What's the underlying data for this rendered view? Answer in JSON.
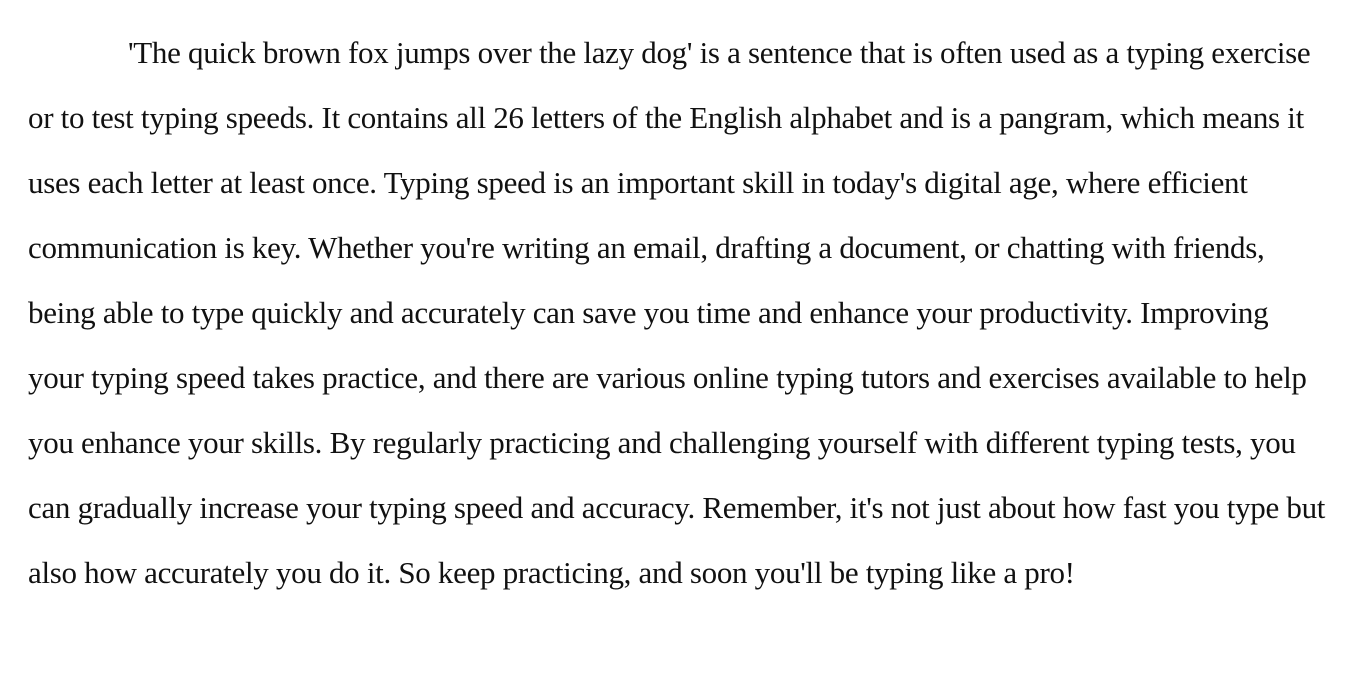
{
  "document": {
    "paragraph": "'The quick brown fox jumps over the lazy dog' is a sentence that is often used as a typing exercise or to test typing speeds. It contains all 26 letters of the English alphabet and is a pangram, which means it uses each letter at least once. Typing speed is an important skill in today's digital age, where efficient communication is key. Whether you're writing an email, drafting a document, or chatting with friends, being able to type quickly and accurately can save you time and enhance your productivity. Improving your typing speed takes practice, and there are various online typing tutors and exercises available to help you enhance your skills. By regularly practicing and challenging yourself with different typing tests, you can gradually increase your typing speed and accuracy. Remember, it's not just about how fast you type but also how accurately you do it. So keep practicing, and soon you'll be typing like a pro!"
  },
  "colors": {
    "text": "#111111",
    "background": "#ffffff"
  }
}
